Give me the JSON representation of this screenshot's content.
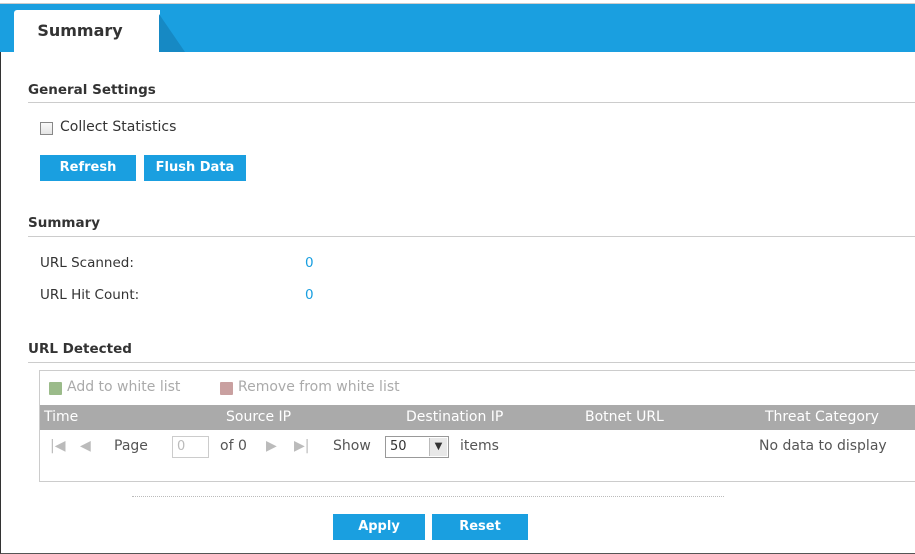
{
  "tabs": [
    {
      "label": "Summary",
      "active": true
    }
  ],
  "general_settings": {
    "title": "General Settings",
    "collect_statistics": {
      "label": "Collect Statistics",
      "checked": false
    },
    "refresh_label": "Refresh",
    "flush_label": "Flush Data"
  },
  "summary": {
    "title": "Summary",
    "url_scanned_label": "URL Scanned:",
    "url_scanned_value": "0",
    "url_hit_label": "URL Hit Count:",
    "url_hit_value": "0"
  },
  "url_detected": {
    "title": "URL Detected",
    "toolbar": {
      "add_label": "Add to white list",
      "remove_label": "Remove from white list"
    },
    "columns": [
      "Time",
      "Source IP",
      "Destination IP",
      "Botnet URL",
      "Threat Category"
    ],
    "pager": {
      "page_label": "Page",
      "page_value": "0",
      "of_label": "of 0",
      "show_label": "Show",
      "show_value": "50",
      "items_label": "items",
      "empty_text": "No data to display"
    }
  },
  "actions": {
    "apply_label": "Apply",
    "reset_label": "Reset"
  },
  "colors": {
    "accent": "#1a9fe0",
    "header_gray": "#aaaaaa"
  },
  "icons": [
    "add-list-icon",
    "remove-list-icon",
    "first-page-icon",
    "prev-page-icon",
    "next-page-icon",
    "last-page-icon",
    "dropdown-arrow-icon"
  ]
}
